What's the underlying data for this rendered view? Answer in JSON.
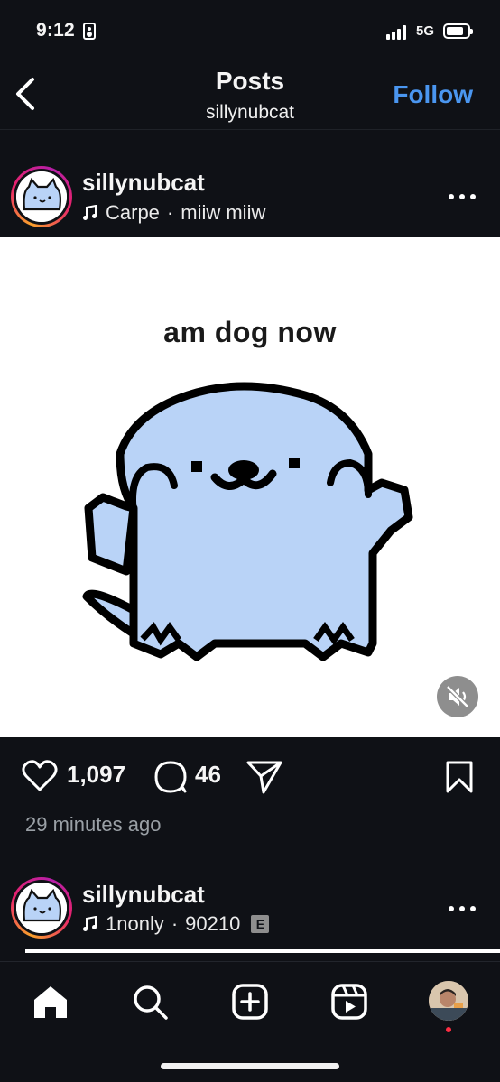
{
  "status_bar": {
    "time": "9:12",
    "network": "5G"
  },
  "header": {
    "title": "Posts",
    "subtitle": "sillynubcat",
    "follow_label": "Follow"
  },
  "post": {
    "username": "sillynubcat",
    "music_title": "Carpe",
    "music_sep": "·",
    "music_artist": "miiw miiw",
    "image_caption": "am dog now",
    "likes": "1,097",
    "comments": "46",
    "time_ago": "29 minutes ago"
  },
  "next_post": {
    "username": "sillynubcat",
    "music_title": "1nonly",
    "music_sep": "·",
    "music_artist": "90210",
    "explicit_badge": "E"
  },
  "icons": {
    "back": "chevron-left-icon",
    "more": "more-horizontal-icon",
    "music": "music-note-icon",
    "mute": "speaker-muted-icon",
    "like": "heart-icon",
    "comment": "comment-icon",
    "share": "send-icon",
    "save": "bookmark-icon",
    "home": "home-icon",
    "search": "search-icon",
    "create": "plus-square-icon",
    "reels": "reels-icon"
  },
  "colors": {
    "background": "#0f1116",
    "accent": "#4a96f0",
    "dog": "#b9d3f7",
    "notification": "#ff2d42"
  }
}
